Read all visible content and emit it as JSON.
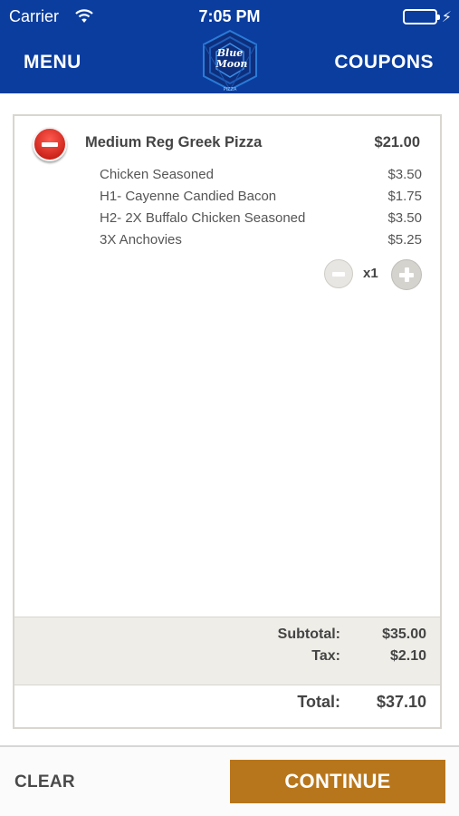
{
  "status_bar": {
    "carrier": "Carrier",
    "time": "7:05 PM",
    "battery_color": "#4cd964"
  },
  "header": {
    "menu_label": "MENU",
    "coupons_label": "COUPONS",
    "logo_text_1": "Blue",
    "logo_text_2": "Moon",
    "logo_text_3": "PIZZA",
    "background_color": "#0a3d9e"
  },
  "cart": {
    "item": {
      "name": "Medium Reg  Greek Pizza",
      "price": "$21.00",
      "quantity": "x1",
      "modifiers": [
        {
          "name": "Chicken Seasoned",
          "price": "$3.50"
        },
        {
          "name": "H1- Cayenne Candied Bacon",
          "price": "$1.75"
        },
        {
          "name": "H2- 2X Buffalo Chicken Seasoned",
          "price": "$3.50"
        },
        {
          "name": "3X Anchovies",
          "price": "$5.25"
        }
      ]
    },
    "summary": {
      "subtotal_label": "Subtotal:",
      "subtotal_value": "$35.00",
      "tax_label": "Tax:",
      "tax_value": "$2.10",
      "total_label": "Total:",
      "total_value": "$37.10"
    }
  },
  "footer": {
    "clear_label": "CLEAR",
    "continue_label": "CONTINUE",
    "continue_color": "#b8761c"
  }
}
